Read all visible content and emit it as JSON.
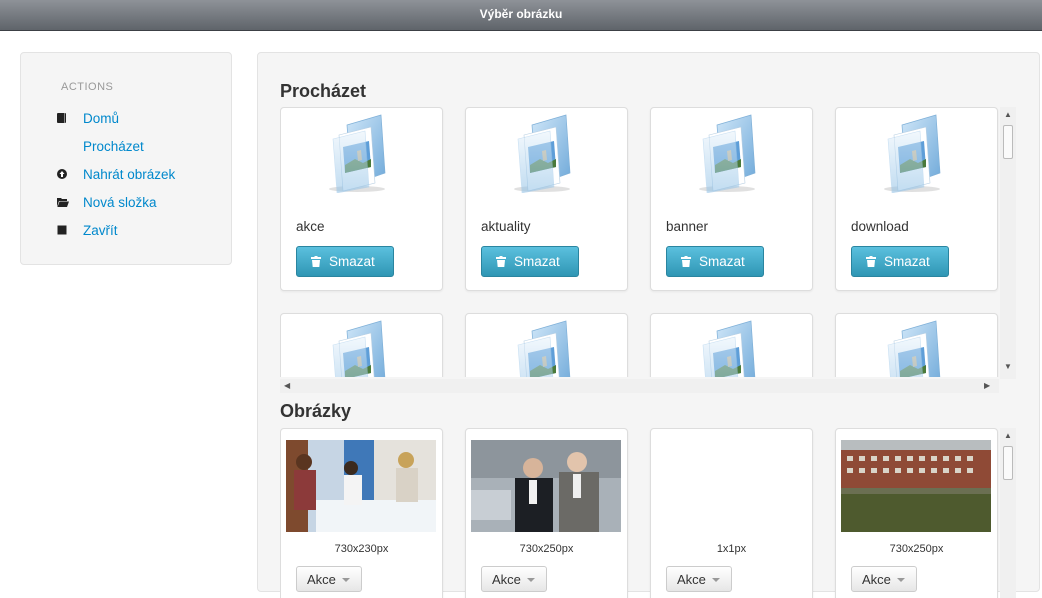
{
  "window": {
    "title": "Výběr obrázku"
  },
  "sidebar": {
    "header": "ACTIONS",
    "items": [
      {
        "label": "Domů",
        "icon": "book-icon"
      },
      {
        "label": "Procházet",
        "icon": ""
      },
      {
        "label": "Nahrát obrázek",
        "icon": "upload-circle-icon"
      },
      {
        "label": "Nová složka",
        "icon": "folder-open-icon"
      },
      {
        "label": "Zavřít",
        "icon": "stop-icon"
      }
    ]
  },
  "browse": {
    "title": "Procházet",
    "folders": [
      {
        "name": "akce",
        "delete_label": "Smazat"
      },
      {
        "name": "aktuality",
        "delete_label": "Smazat"
      },
      {
        "name": "banner",
        "delete_label": "Smazat"
      },
      {
        "name": "download",
        "delete_label": "Smazat"
      }
    ]
  },
  "images": {
    "title": "Obrázky",
    "items": [
      {
        "dimensions": "730x230px",
        "action_label": "Akce"
      },
      {
        "dimensions": "730x250px",
        "action_label": "Akce"
      },
      {
        "dimensions": "1x1px",
        "action_label": "Akce"
      },
      {
        "dimensions": "730x250px",
        "action_label": "Akce"
      }
    ]
  },
  "colors": {
    "link": "#0088cc",
    "danger_button": "#2f96b4",
    "titlebar": "#6b7076"
  }
}
